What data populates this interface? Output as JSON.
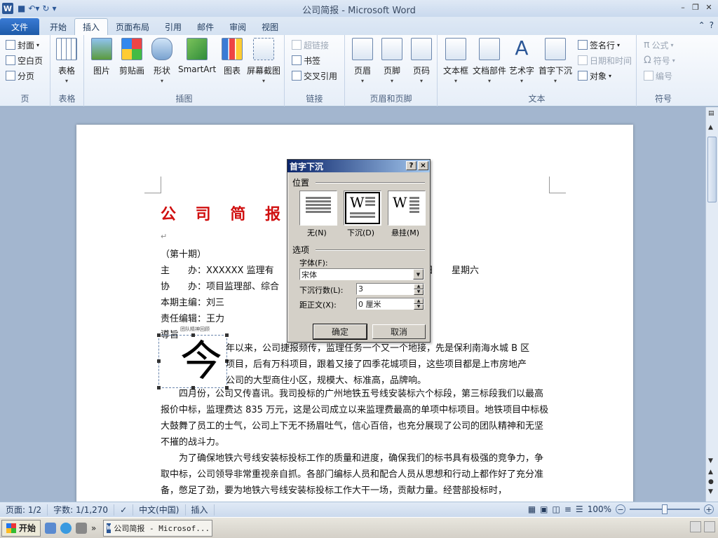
{
  "window": {
    "title": "公司简报 - Microsoft Word"
  },
  "tabs": [
    {
      "label": "文件"
    },
    {
      "label": "开始"
    },
    {
      "label": "插入"
    },
    {
      "label": "页面布局"
    },
    {
      "label": "引用"
    },
    {
      "label": "邮件"
    },
    {
      "label": "审阅"
    },
    {
      "label": "视图"
    }
  ],
  "ribbon": {
    "pages": {
      "label": "页",
      "cover": "封面",
      "blank": "空白页",
      "break": "分页"
    },
    "tables": {
      "label": "表格",
      "table": "表格"
    },
    "illustrations": {
      "label": "插图",
      "picture": "图片",
      "clipart": "剪贴画",
      "shapes": "形状",
      "smartart": "SmartArt",
      "chart": "图表",
      "screenshot": "屏幕截图"
    },
    "links": {
      "label": "链接",
      "hyperlink": "超链接",
      "bookmark": "书签",
      "crossref": "交叉引用"
    },
    "header_footer": {
      "label": "页眉和页脚",
      "header": "页眉",
      "footer": "页脚",
      "page_number": "页码"
    },
    "text": {
      "label": "文本",
      "textbox": "文本框",
      "quickparts": "文档部件",
      "wordart": "艺术字",
      "dropcap": "首字下沉",
      "signature": "签名行",
      "datetime": "日期和时间",
      "object": "对象"
    },
    "symbols": {
      "label": "符号",
      "equation": "公式",
      "symbol": "符号",
      "number": "编号"
    }
  },
  "document": {
    "title": "公 司 简 报",
    "issue": "（第十期）",
    "host": "主　　办：XXXXXX 监理有",
    "host_tail": "日　　星期六",
    "coorg": "协　　办：项目监理部、综合",
    "editor_in_chief": "本期主编：刘三",
    "editor": "责任编辑：王力",
    "lead": "導旨",
    "tiny_note": "团队精神回顾",
    "drop_cap": "今",
    "p1_l1": "年以来，公司捷报频传，监理任务一个又一个地接，先是保利南海水城 B 区",
    "p1_l2": "项目，后有万科项目，跟着又接了四季花城项目，这些项目都是上市房地产",
    "p1_l3": "公司的大型商住小区，规模大、标准高，品牌响。",
    "p2": "四月份，公司又传喜讯。我司投标的广州地铁五号线安装标六个标段，第三标段我们以最高报价中标，监理费达 835 万元，这是公司成立以来监理费最高的单项中标项目。地铁项目中标极大鼓舞了员工的士气，公司上下无不扬眉吐气，信心百倍，也充分展现了公司的团队精神和无坚不摧的战斗力。",
    "p3": "为了确保地铁六号线安装标投标工作的质量和进度，确保我们的标书具有极强的竞争力，争取中标，公司领导非常重视亲自抓。各部门编标人员和配合人员从思想和行动上都作好了充分准备，憋足了劲，要为地铁六号线安装标投标工作大干一场，贡献力量。经营部投标时，"
  },
  "dialog": {
    "title": "首字下沉",
    "position_label": "位置",
    "opt_none": "无(N)",
    "opt_drop": "下沉(D)",
    "opt_margin": "悬挂(M)",
    "options_label": "选项",
    "font_label": "字体(F):",
    "font_value": "宋体",
    "lines_label": "下沉行数(L):",
    "lines_value": "3",
    "distance_label": "距正文(X):",
    "distance_value": "0 厘米",
    "ok": "确定",
    "cancel": "取消",
    "help": "?",
    "close": "×"
  },
  "status": {
    "page": "页面: 1/2",
    "words": "字数: 1/1,270",
    "language": "中文(中国)",
    "mode": "插入",
    "zoom": "100%",
    "zoom_level": 100
  },
  "taskbar": {
    "start": "开始",
    "task_title": "公司简报 - Microsof..."
  },
  "colors": {
    "doc_title": "#d01010",
    "file_tab": "#1d5aa8",
    "dialog_title": "#0a246a"
  }
}
